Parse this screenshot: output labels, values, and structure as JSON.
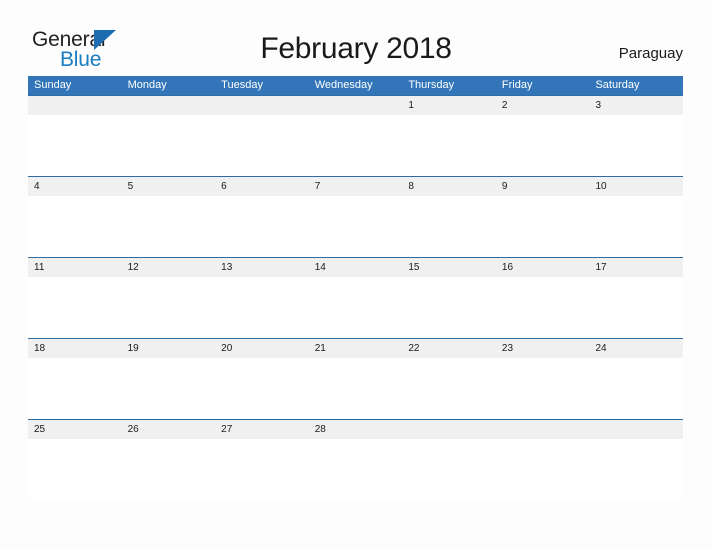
{
  "brand": {
    "name_part1": "General",
    "name_part2": "Blue",
    "triangle_icon": "blue-triangle-logo-mark",
    "color_dark": "#231f20",
    "color_blue": "#1b7cc2"
  },
  "header": {
    "title": "February 2018",
    "region": "Paraguay"
  },
  "calendar": {
    "accent_color": "#3275b8",
    "separator_color": "#2e6da4",
    "band_color": "#f0f0f0",
    "weekdays": [
      "Sunday",
      "Monday",
      "Tuesday",
      "Wednesday",
      "Thursday",
      "Friday",
      "Saturday"
    ],
    "weeks": [
      [
        "",
        "",
        "",
        "",
        "1",
        "2",
        "3"
      ],
      [
        "4",
        "5",
        "6",
        "7",
        "8",
        "9",
        "10"
      ],
      [
        "11",
        "12",
        "13",
        "14",
        "15",
        "16",
        "17"
      ],
      [
        "18",
        "19",
        "20",
        "21",
        "22",
        "23",
        "24"
      ],
      [
        "25",
        "26",
        "27",
        "28",
        "",
        "",
        ""
      ]
    ]
  }
}
